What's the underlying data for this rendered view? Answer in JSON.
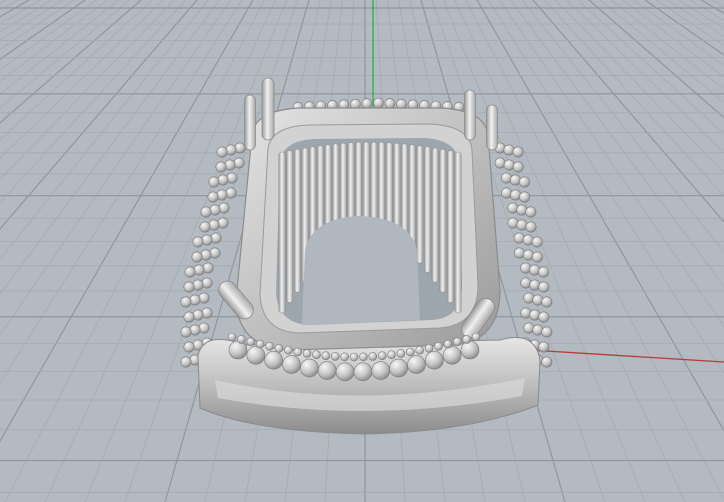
{
  "viewport": {
    "label": "",
    "background_color": "#b3bac1",
    "grid": true,
    "grid_minor_color": "#a3abb3",
    "grid_major_color": "#8e969e",
    "axis_colors": {
      "x": "#c0353a",
      "y": "#2fae45",
      "z": "#3955c8"
    }
  },
  "model": {
    "type": "ring",
    "material_color": "#c9c9c9",
    "center_stone_setting": "cushion",
    "prong_count": 4
  }
}
